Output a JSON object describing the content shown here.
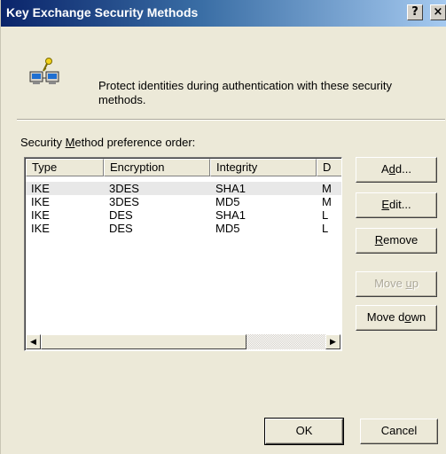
{
  "window": {
    "title": "Key Exchange Security Methods",
    "caption_buttons": [
      "?",
      "×"
    ]
  },
  "header": {
    "icon": "network-key-icon",
    "description": "Protect identities during authentication with these security methods."
  },
  "list": {
    "label": "Security Method preference order:",
    "columns": [
      "Type",
      "Encryption",
      "Integrity",
      "D"
    ],
    "rows": [
      {
        "type": "IKE",
        "encryption": "3DES",
        "integrity": "SHA1",
        "d": "M"
      },
      {
        "type": "IKE",
        "encryption": "3DES",
        "integrity": "MD5",
        "d": "M"
      },
      {
        "type": "IKE",
        "encryption": "DES",
        "integrity": "SHA1",
        "d": "L"
      },
      {
        "type": "IKE",
        "encryption": "DES",
        "integrity": "MD5",
        "d": "L"
      }
    ],
    "selected_row": 0
  },
  "buttons": {
    "add": "Add...",
    "edit": "Edit...",
    "remove": "Remove",
    "move_up": "Move up",
    "move_down": "Move down",
    "ok": "OK",
    "cancel": "Cancel"
  },
  "colors": {
    "dialog_bg": "#ece9d8",
    "title_start": "#0a246a",
    "title_end": "#a6caf0",
    "disabled_text": "#aca899"
  }
}
